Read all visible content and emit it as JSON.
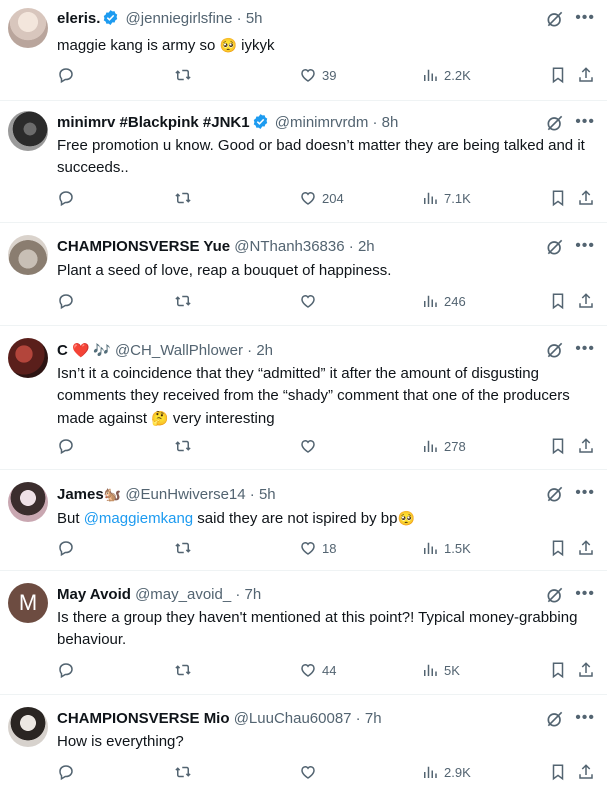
{
  "tweets": [
    {
      "name": "eleris.",
      "verified": true,
      "handle": "@jenniegirlsfine",
      "time": "5h",
      "text_parts": [
        "maggie kang is army so ",
        "🥺",
        " iykyk"
      ],
      "replies": "",
      "retweets": "",
      "likes": "39",
      "views": "2.2K"
    },
    {
      "name": "minimrv #Blackpink #JNK1",
      "verified": true,
      "handle": "@minimrvrdm",
      "time": "8h",
      "text": "Free promotion u know. Good or bad doesn’t matter they are being talked and it succeeds..",
      "replies": "",
      "retweets": "",
      "likes": "204",
      "views": "7.1K"
    },
    {
      "name": "CHAMPIONSVERSE Yue",
      "verified": false,
      "handle": "@NThanh36836",
      "time": "2h",
      "text": "Plant a seed of love, reap a bouquet of happiness.",
      "replies": "",
      "retweets": "",
      "likes": "",
      "views": "246"
    },
    {
      "name": "C",
      "name_emoji": "❤️ 🎶",
      "verified": false,
      "handle": "@CH_WallPhlower",
      "time": "2h",
      "text_parts": [
        "Isn’t it a coincidence that they “admitted” it after the amount of disgusting comments they received from the “shady” comment that one of the producers made against ",
        "🤔",
        " very interesting"
      ],
      "replies": "",
      "retweets": "",
      "likes": "",
      "views": "278"
    },
    {
      "name": "James",
      "name_emoji": "🐿️",
      "verified": false,
      "handle": "@EunHwiverse14",
      "time": "5h",
      "text_parts": [
        "But ",
        "@maggiemkang",
        " said they are not ispired by bp",
        "🥺"
      ],
      "replies": "",
      "retweets": "",
      "likes": "18",
      "views": "1.5K"
    },
    {
      "name": "May Avoid",
      "verified": false,
      "handle": "@may_avoid_",
      "time": "7h",
      "avatar_letter": "M",
      "text": "Is there a group they haven't mentioned at this point?! Typical money-grabbing behaviour.",
      "replies": "",
      "retweets": "",
      "likes": "44",
      "views": "5K"
    },
    {
      "name": "CHAMPIONSVERSE Mio",
      "verified": false,
      "handle": "@LuuChau60087",
      "time": "7h",
      "text": "How is everything?",
      "replies": "",
      "retweets": "",
      "likes": "",
      "views": "2.9K"
    }
  ],
  "icons": {
    "reply": "reply-icon",
    "retweet": "retweet-icon",
    "like": "heart-icon",
    "views": "views-icon",
    "bookmark": "bookmark-icon",
    "share": "share-icon",
    "grok": "grok-icon",
    "more": "more-icon"
  },
  "colors": {
    "text": "#0f1419",
    "secondary": "#536471",
    "link": "#1d9bf0",
    "verified": "#1d9bf0",
    "divider": "#eff3f4"
  }
}
